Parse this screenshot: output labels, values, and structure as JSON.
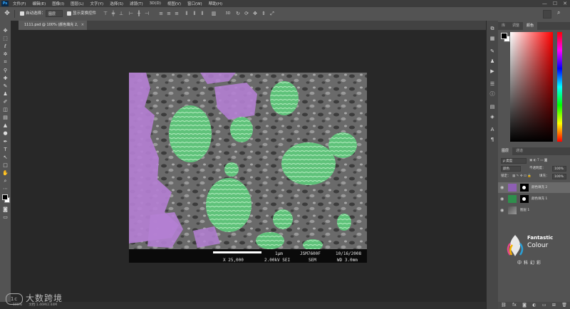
{
  "menu": {
    "app_logo": "Ps",
    "items": [
      "文件(F)",
      "编辑(E)",
      "图像(I)",
      "图层(L)",
      "文字(Y)",
      "选择(S)",
      "滤镜(T)",
      "3D(D)",
      "视图(V)",
      "窗口(W)",
      "帮助(H)"
    ],
    "controls": [
      "—",
      "☐",
      "✕"
    ]
  },
  "options": {
    "auto_select_label": "自动选择：",
    "auto_select_value": "图层",
    "show_transform_label": "显示变换控件"
  },
  "document": {
    "tab_title": "1111.psd @ 100% (颜色填充 2, RGB/8)",
    "tab_modified": "*",
    "close": "×"
  },
  "image": {
    "scale_label": "1μm",
    "instrument": "JSM7600F",
    "date": "10/16/2008",
    "magnification": "X 25,000",
    "voltage": "2.00kV SEI",
    "mode": "SEM",
    "working_distance": "WD 3.0mm"
  },
  "panels": {
    "top_tabs": [
      "库",
      "调整",
      "颜色"
    ],
    "top_active": "颜色",
    "layer_tabs": [
      "图层",
      "通道"
    ],
    "layer_active": "图层",
    "filter_kind": "ρ 类型",
    "blend_mode": "颜色",
    "opacity_label": "不透明度：",
    "opacity_value": "100%",
    "lock_label": "锁定：",
    "fill_label": "填充：",
    "fill_value": "100%",
    "layers": [
      {
        "name": "颜色填充 2",
        "thumb_color": "#8e5fb3",
        "selected": true
      },
      {
        "name": "颜色填充 1",
        "thumb_color": "#2f8f4c",
        "selected": false
      },
      {
        "name": "图层 1",
        "thumb_color": "#8a8a8a",
        "selected": false
      }
    ]
  },
  "logo": {
    "line1": "Fantastic",
    "line2": "Colour",
    "line3": "中科幻彩"
  },
  "status": {
    "zoom": "100%",
    "doc": "文档:1.46M/2.44M"
  },
  "watermark": {
    "mark": "1c",
    "text": "大数跨境"
  },
  "colors": {
    "purple": "#b47fd3",
    "green": "#5fc27a",
    "sem_gray": "#6d6d6d"
  }
}
